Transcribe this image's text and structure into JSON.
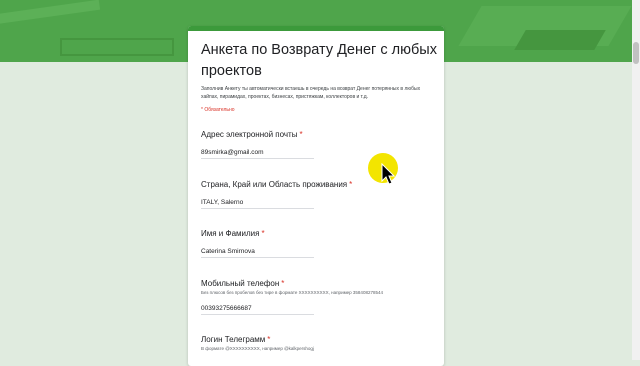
{
  "form": {
    "title": "Анкета по Возврату Денег с любых проектов",
    "description": "Заполнив Анкету ты автоматически встаешь в очередь на возврат Денег потерянных в любых хайпах, пирамидах, проектах, бизнесах, пристяжкам, коллекторов и т.д.",
    "required_note": "* Обязательно",
    "questions": [
      {
        "label": "Адрес электронной почты",
        "hint": "",
        "value": "89smirka@gmail.com",
        "required": "*"
      },
      {
        "label": "Страна, Край или Область проживания",
        "hint": "",
        "value": "ITALY, Salerno",
        "required": "*"
      },
      {
        "label": "Имя и Фамилия",
        "hint": "",
        "value": "Caterina Smirnova",
        "required": "*"
      },
      {
        "label": "Мобильный телефон",
        "hint": "Без плюсов без пробелов без тире в формате XXXXXXXXXX, например 358408278544",
        "value": "00393275666687",
        "required": "*"
      },
      {
        "label": "Логин Телеграмм",
        "hint": "В формате @XXXXXXXXXX, например @kalkpershogj",
        "value": "",
        "required": "*"
      }
    ]
  },
  "colors": {
    "header_green": "#4fa54b",
    "accent_green": "#3c9a3b",
    "required_red": "#d93025",
    "cursor_highlight": "#f3e500"
  }
}
